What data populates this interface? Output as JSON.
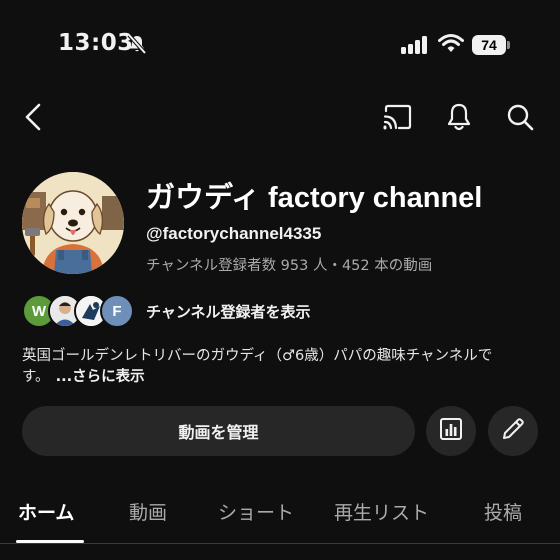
{
  "status_bar": {
    "time": "13:03",
    "battery_level": "74",
    "icons": [
      "bell-slash-icon",
      "signal-icon",
      "wifi-icon",
      "battery-icon"
    ]
  },
  "app_bar": {
    "icons": [
      "back-arrow-icon",
      "cast-icon",
      "bell-icon",
      "search-icon"
    ]
  },
  "channel": {
    "title": "ガウディ factory channel",
    "handle": "@factorychannel4335",
    "stats": "チャンネル登録者数 953 人・452 本の動画",
    "subscribers_label": "チャンネル登録者を表示",
    "subscriber_initials": [
      "W",
      "",
      "",
      "F"
    ],
    "description": "英国ゴールデンレトリバーのガウディ（♂6歳）パパの趣味チャンネルです。",
    "more_label": "...さらに表示"
  },
  "actions": {
    "manage_label": "動画を管理",
    "icons": [
      "analytics-icon",
      "edit-pencil-icon"
    ]
  },
  "tabs": [
    {
      "label": "ホーム",
      "active": true
    },
    {
      "label": "動画",
      "active": false
    },
    {
      "label": "ショート",
      "active": false
    },
    {
      "label": "再生リスト",
      "active": false
    },
    {
      "label": "投稿",
      "active": false
    }
  ],
  "colors": {
    "background": "#0f0f0f",
    "button_bg": "#272727",
    "secondary_text": "#aaaaaa"
  }
}
